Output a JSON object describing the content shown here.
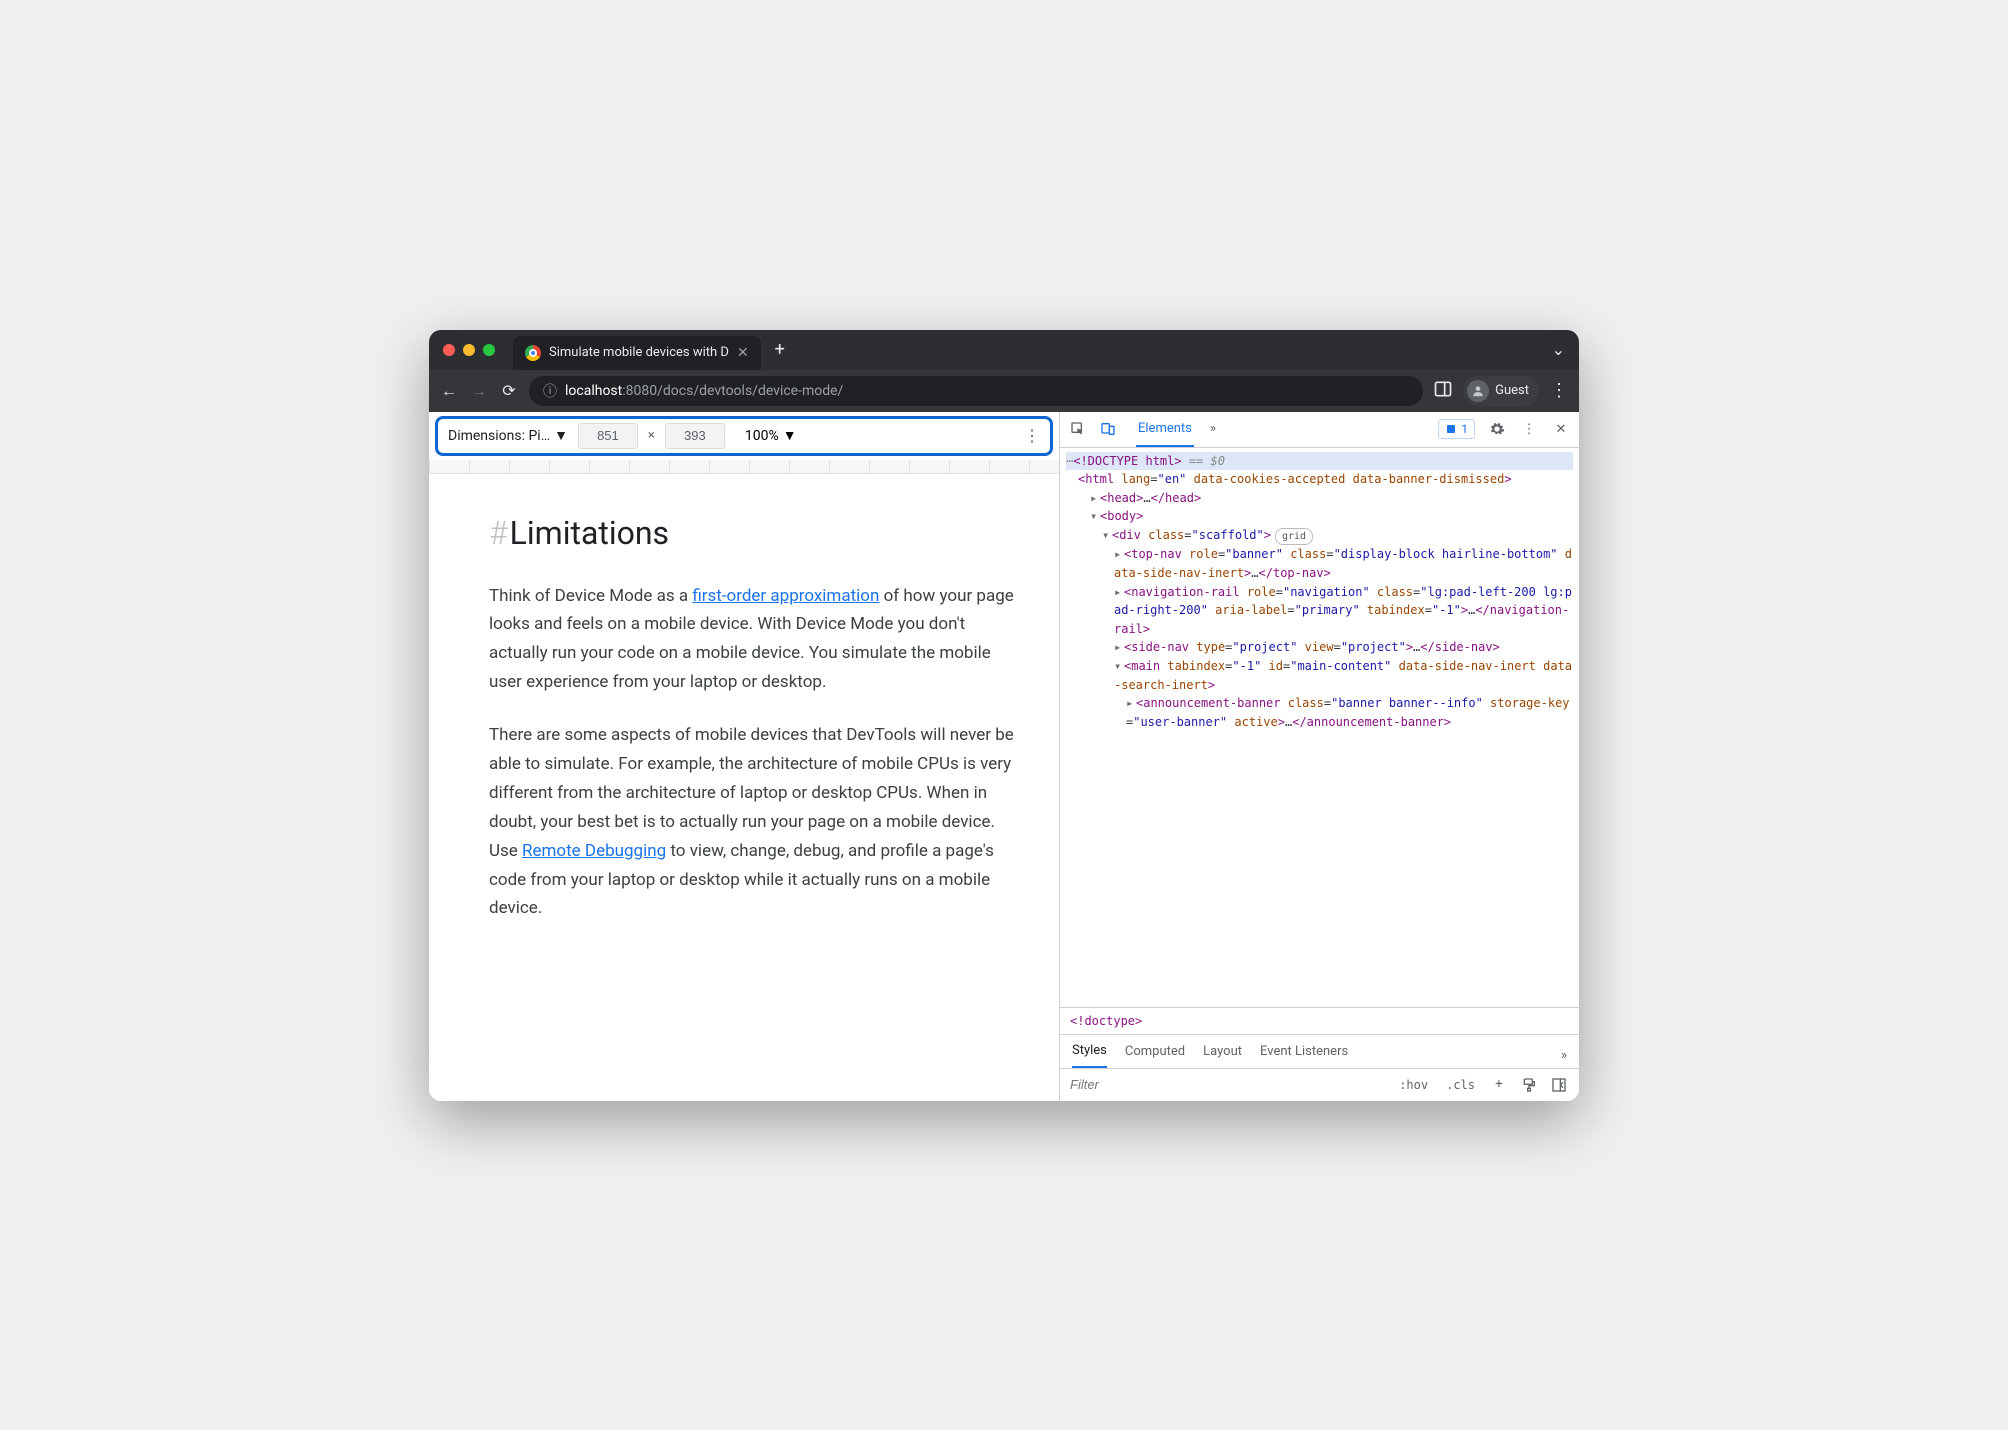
{
  "browser": {
    "tab_title": "Simulate mobile devices with D",
    "url_host": "localhost",
    "url_port": ":8080",
    "url_path": "/docs/devtools/device-mode/",
    "profile_label": "Guest"
  },
  "device_toolbar": {
    "dimensions_label": "Dimensions: Pi…",
    "width": "851",
    "height": "393",
    "times": "×",
    "zoom": "100%"
  },
  "page": {
    "heading": "Limitations",
    "hash": "#",
    "p1_a": "Think of Device Mode as a ",
    "p1_link": "first-order approximation",
    "p1_b": " of how your page looks and feels on a mobile device. With Device Mode you don't actually run your code on a mobile device. You simulate the mobile user experience from your laptop or desktop.",
    "p2_a": "There are some aspects of mobile devices that DevTools will never be able to simulate. For example, the architecture of mobile CPUs is very different from the architecture of laptop or desktop CPUs. When in doubt, your best bet is to actually run your page on a mobile device. Use ",
    "p2_link": "Remote Debugging",
    "p2_b": " to view, change, debug, and profile a page's code from your laptop or desktop while it actually runs on a mobile device."
  },
  "devtools": {
    "tabs": {
      "elements": "Elements"
    },
    "issues_count": "1",
    "breadcrumb": "!doctype",
    "styles_tabs": {
      "styles": "Styles",
      "computed": "Computed",
      "layout": "Layout",
      "event_listeners": "Event Listeners"
    },
    "filter_placeholder": "Filter",
    "hov": ":hov",
    "cls": ".cls",
    "dom": {
      "doctype": "<!DOCTYPE html>",
      "selected_suffix": " == $0",
      "html_open": "<html lang=\"en\" data-cookies-accepted data-banner-dismissed>",
      "head": "<head>…</head>",
      "body_open": "<body>",
      "div_scaffold": "<div class=\"scaffold\">",
      "grid_badge": "grid",
      "topnav": "<top-nav role=\"banner\" class=\"display-block hairline-bottom\" data-side-nav-inert>…</top-nav>",
      "navrail": "<navigation-rail role=\"navigation\" class=\"lg:pad-left-200 lg:pad-right-200\" aria-label=\"primary\" tabindex=\"-1\">…</navigation-rail>",
      "sidenav": "<side-nav type=\"project\" view=\"project\">…</side-nav>",
      "main_open": "<main tabindex=\"-1\" id=\"main-content\" data-side-nav-inert data-search-inert>",
      "announce": "<announcement-banner class=\"banner banner--info\" storage-key=\"user-banner\" active>…</announcement-banner>"
    }
  }
}
